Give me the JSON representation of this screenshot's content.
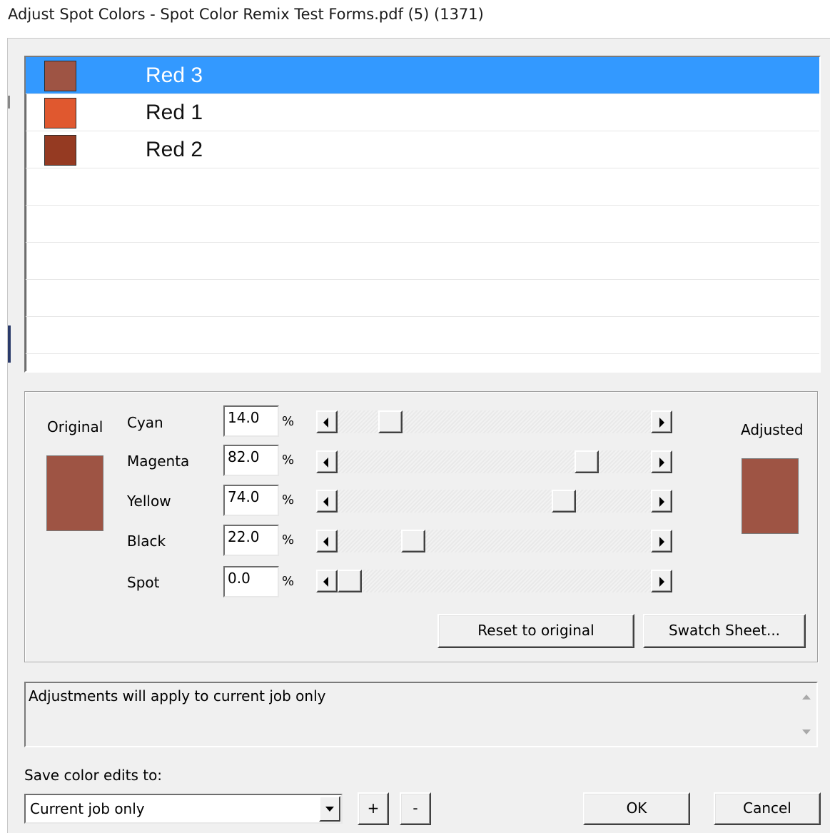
{
  "window": {
    "title": "Adjust Spot Colors - Spot Color Remix Test Forms.pdf (5) (1371)"
  },
  "colors": {
    "selection": "#3399ff",
    "red3": "#9e5444",
    "red1": "#e0582f",
    "red2": "#953a22"
  },
  "spot_list": [
    {
      "name": "Red 3",
      "swatch": "#9e5444",
      "selected": true
    },
    {
      "name": "Red 1",
      "swatch": "#e0582f",
      "selected": false
    },
    {
      "name": "Red 2",
      "swatch": "#953a22",
      "selected": false
    }
  ],
  "adjust": {
    "original_label": "Original",
    "adjusted_label": "Adjusted",
    "original_color": "#9e5444",
    "adjusted_color": "#9e5444",
    "channels": [
      {
        "name": "Cyan",
        "value": "14.0",
        "unit": "%",
        "level": 14.0
      },
      {
        "name": "Magenta",
        "value": "82.0",
        "unit": "%",
        "level": 82.0
      },
      {
        "name": "Yellow",
        "value": "74.0",
        "unit": "%",
        "level": 74.0
      },
      {
        "name": "Black",
        "value": "22.0",
        "unit": "%",
        "level": 22.0
      },
      {
        "name": "Spot",
        "value": "0.0",
        "unit": "%",
        "level": 0.0
      }
    ],
    "reset_label": "Reset to original",
    "swatch_sheet_label": "Swatch Sheet..."
  },
  "status": {
    "message": "Adjustments will apply to current job only"
  },
  "save": {
    "label": "Save color edits to:",
    "selected": "Current job only",
    "add_label": "+",
    "remove_label": "-"
  },
  "footer": {
    "ok_label": "OK",
    "cancel_label": "Cancel"
  }
}
